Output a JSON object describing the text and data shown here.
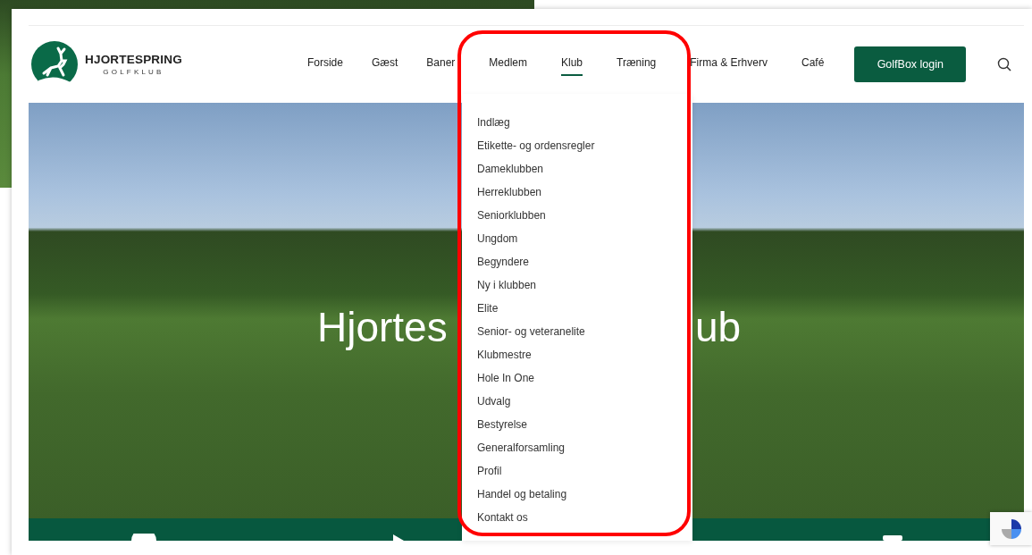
{
  "logo": {
    "name": "HJORTESPRING",
    "subtitle": "GOLFKLUB"
  },
  "nav": [
    {
      "label": "Forside",
      "selected": false
    },
    {
      "label": "Gæst",
      "selected": false
    },
    {
      "label": "Baner",
      "selected": false
    },
    {
      "label": "Medlem",
      "selected": false
    },
    {
      "label": "Klub",
      "selected": true
    },
    {
      "label": "Træning",
      "selected": false
    },
    {
      "label": "Firma & Erhverv",
      "selected": false
    },
    {
      "label": "Café",
      "selected": false
    }
  ],
  "login_button": "GolfBox login",
  "dropdown": {
    "items": [
      "Indlæg",
      "Etikette- og ordensregler",
      "Dameklubben",
      "Herreklubben",
      "Seniorklubben",
      "Ungdom",
      "Begyndere",
      "Ny i klubben",
      "Elite",
      "Senior- og veteranelite",
      "Klubmestre",
      "Hole In One",
      "Udvalg",
      "Bestyrelse",
      "Generalforsamling",
      "Profil",
      "Handel og betaling",
      "Kontakt os"
    ]
  },
  "hero": {
    "title_parts": [
      "Hjortes",
      "ub"
    ]
  }
}
